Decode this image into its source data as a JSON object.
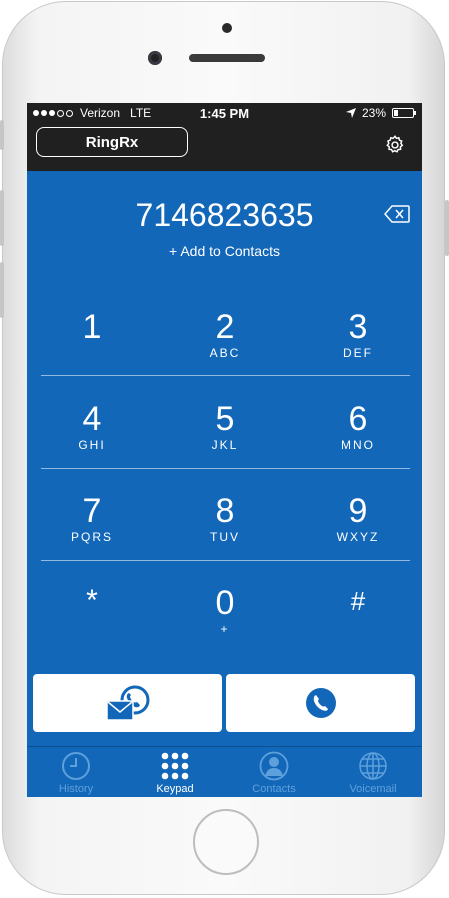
{
  "status": {
    "carrier": "Verizon",
    "network": "LTE",
    "time": "1:45 PM",
    "battery": "23%",
    "battery_level": 0.23
  },
  "header": {
    "app_title": "RingRx",
    "settings_icon": "gear-icon"
  },
  "dialer": {
    "number": "7146823635",
    "add_to_contacts": "+ Add to Contacts",
    "backspace_icon": "backspace-icon"
  },
  "keypad": {
    "keys": [
      {
        "digit": "1",
        "letters": ""
      },
      {
        "digit": "2",
        "letters": "ABC"
      },
      {
        "digit": "3",
        "letters": "DEF"
      },
      {
        "digit": "4",
        "letters": "GHI"
      },
      {
        "digit": "5",
        "letters": "JKL"
      },
      {
        "digit": "6",
        "letters": "MNO"
      },
      {
        "digit": "7",
        "letters": "PQRS"
      },
      {
        "digit": "8",
        "letters": "TUV"
      },
      {
        "digit": "9",
        "letters": "WXYZ"
      },
      {
        "digit": "*",
        "letters": ""
      },
      {
        "digit": "0",
        "letters": "+"
      },
      {
        "digit": "#",
        "letters": ""
      }
    ]
  },
  "actions": {
    "voicemail_call_icon": "envelope-phone-icon",
    "call_icon": "phone-icon"
  },
  "tabs": [
    {
      "label": "History",
      "icon": "clock-icon",
      "active": false
    },
    {
      "label": "Keypad",
      "icon": "keypad-grid-icon",
      "active": true
    },
    {
      "label": "Contacts",
      "icon": "person-icon",
      "active": false
    },
    {
      "label": "Voicemail",
      "icon": "globe-icon",
      "active": false
    }
  ],
  "colors": {
    "primary_blue": "#1367b8",
    "status_bar": "#202020",
    "tab_inactive": "#5ea0dc"
  }
}
